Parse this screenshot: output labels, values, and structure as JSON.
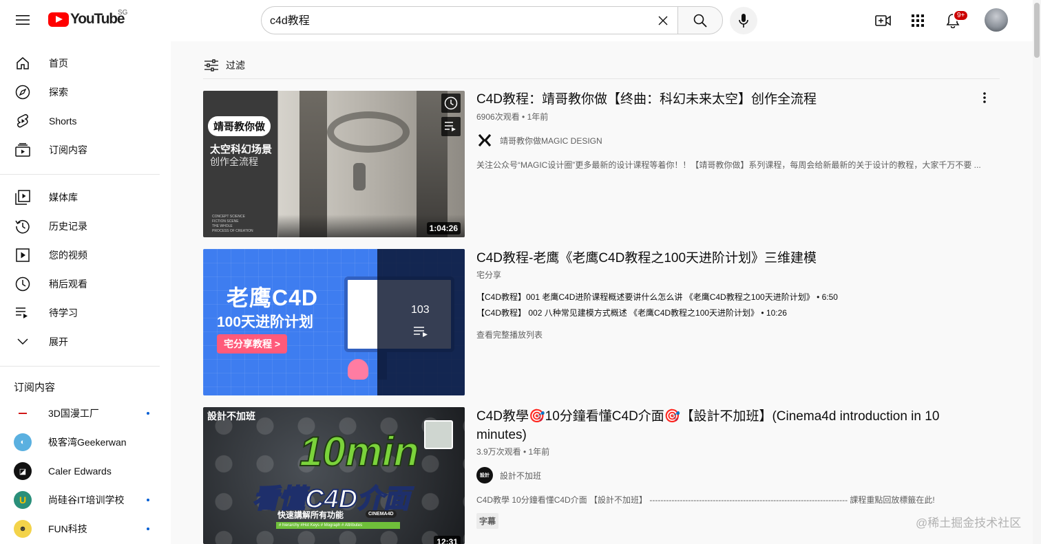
{
  "header": {
    "logo_text": "YouTube",
    "country_code": "SG",
    "search_value": "c4d教程",
    "notifications_count": "9+"
  },
  "sidebar": {
    "main_items": [
      {
        "label": "首页",
        "icon": "home-icon"
      },
      {
        "label": "探索",
        "icon": "compass-icon"
      },
      {
        "label": "Shorts",
        "icon": "shorts-icon"
      },
      {
        "label": "订阅内容",
        "icon": "subscriptions-icon"
      }
    ],
    "library_items": [
      {
        "label": "媒体库",
        "icon": "library-icon"
      },
      {
        "label": "历史记录",
        "icon": "history-icon"
      },
      {
        "label": "您的视频",
        "icon": "your-videos-icon"
      },
      {
        "label": "稍后观看",
        "icon": "watch-later-icon"
      },
      {
        "label": "待学习",
        "icon": "playlist-icon"
      },
      {
        "label": "展开",
        "icon": "chevron-down-icon"
      }
    ],
    "subscriptions_title": "订阅内容",
    "subscriptions": [
      {
        "name": "3D国漫工厂",
        "new": true
      },
      {
        "name": "极客湾Geekerwan",
        "new": false
      },
      {
        "name": "Caler Edwards",
        "new": false
      },
      {
        "name": "尚硅谷IT培训学校",
        "new": true
      },
      {
        "name": "FUN科技",
        "new": true
      }
    ]
  },
  "filter": {
    "label": "过滤"
  },
  "results": [
    {
      "title": "C4D教程：靖哥教你做【终曲：科幻未来太空】创作全流程",
      "meta": "6906次观看 • 1年前",
      "channel": "靖哥教你做MAGIC DESIGN",
      "description": "关注公众号“MAGIC设计圈”更多最新的设计课程等着你！！【靖哥教你做】系列课程，每周会给新最新的关于设计的教程，大家千万不要 ...",
      "duration": "1:04:26",
      "thumb_badge": "靖哥教你做",
      "thumb_title": "太空科幻场景",
      "thumb_subtitle": "创作全流程",
      "thumb_small": [
        "CONCEPT SCIENCE",
        "FICTION SCENE",
        "THE WHOLE",
        "PROCESS OF CREATION"
      ]
    },
    {
      "title": "C4D教程-老鹰《老鹰C4D教程之100天进阶计划》三维建模",
      "meta": "宅分享",
      "playlist_count": "103",
      "thumb_title": "老鹰C4D",
      "thumb_subtitle": "100天进阶计划",
      "thumb_button": "宅分享教程 >",
      "playlist_items": [
        "【C4D教程】001 老鹰C4D进阶课程概述要讲什么怎么讲 《老鹰C4D教程之100天进阶计划》 • 6:50",
        "【C4D教程】 002 八种常见建模方式概述 《老鹰C4D教程之100天进阶计划》 • 10:26"
      ],
      "playlist_link": "查看完整播放列表"
    },
    {
      "title": "C4D教學🎯10分鐘看懂C4D介面🎯【設計不加班】(Cinema4d introduction in 10 minutes)",
      "meta": "3.9万次观看 • 1年前",
      "channel": "設計不加班",
      "description": "C4D教學 10分鐘看懂C4D介面 【設計不加班】 ------------------------------------------------------------------------ 課程重點回放標籤在此!",
      "tag": "字幕",
      "duration": "12:31",
      "thumb_brand": "設計不加班",
      "thumb_big": "10min",
      "thumb_title": "看懂C4D介面",
      "thumb_subtitle": "快速講解所有功能",
      "thumb_badge": "CINEMA4D",
      "thumb_small": "# hierarchy #Hot Keys # Mograph # Attributes"
    }
  ],
  "watermark": "@稀土掘金技术社区"
}
